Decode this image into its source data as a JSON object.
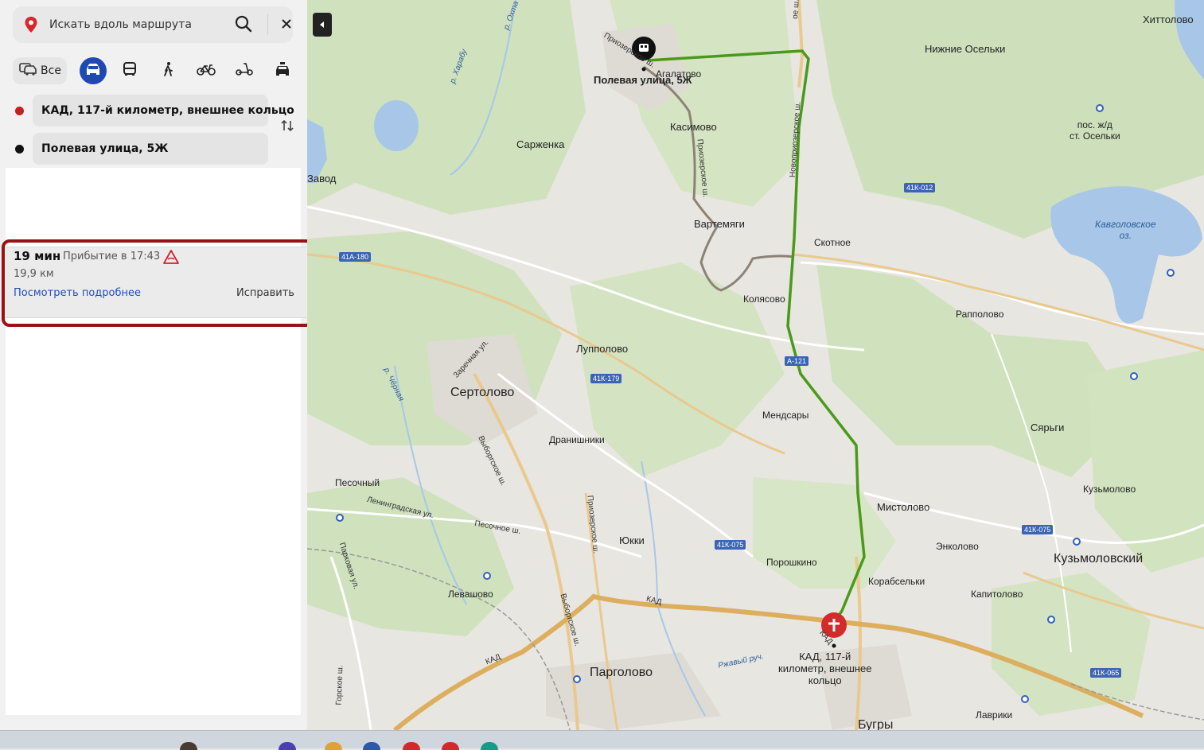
{
  "search": {
    "placeholder": "Искать вдоль маршрута"
  },
  "modes": {
    "all_label": "Все",
    "selected": "car",
    "accent": "#1f48b2"
  },
  "waypoints": {
    "from": "КАД, 117-й километр, внешнее кольцо",
    "to": "Полевая улица, 5Ж",
    "from_color": "#c81e1e",
    "to_color": "#111111"
  },
  "route": {
    "time": "19 мин",
    "arrival": "Прибытие в 17:43",
    "distance": "19,9 км",
    "details_link": "Посмотреть подробнее",
    "fix_button": "Исправить",
    "highlight_color": "#9c0f16",
    "route_color": "#4a9a1a"
  },
  "map": {
    "places": {
      "hittolovo": "Хиттолово",
      "nizhnie_oselki": "Нижние Осельки",
      "agalatovo": "Агалатово",
      "polevaya": "Полевая улица, 5Ж",
      "kasimovo": "Касимово",
      "sarzhenka": "Сарженка",
      "zavod": "Завод",
      "pos_oselki": "пос. ж/д\nст. Осельки",
      "vartemyagi": "Вартемяги",
      "skotnoe": "Скотное",
      "kavgolovskoe": "Кавголовское\nоз.",
      "kolyasovo": "Колясово",
      "rappolovo": "Рапполово",
      "luppolovo": "Лупполово",
      "sertolovo": "Сертолово",
      "mendsary": "Мендсары",
      "saryagi": "Сярьги",
      "dranishniki": "Дранишники",
      "pesochny": "Песочный",
      "kuzmolovo": "Кузьмолово",
      "mistolovo": "Мистолово",
      "yukki": "Юкки",
      "enkolovo": "Энколово",
      "kuzmolovsky": "Кузьмоловский",
      "poroshkino": "Порошкино",
      "korabselki": "Корабсельки",
      "levashovo": "Левашово",
      "kapitolovo": "Капитолово",
      "kad_point": "КАД, 117-й\nкилометр, внешнее\nкольцо",
      "pargolovo": "Парголово",
      "lavriki": "Лаврики",
      "bugry": "Бугры"
    },
    "roads": {
      "kad1": "КАД",
      "kad2": "КАД",
      "kad3": "КАД",
      "vyborgskoe": "Выборгское ш.",
      "vyborgskoe2": "Выборгское ш.",
      "novopriozerskoe": "Новоприозерское ш.",
      "priozerskoe": "Приозерское ш.",
      "priozerskoe2": "Приозерское ш.",
      "priozerskoe3": "Приозерское ш.",
      "leningradskaya": "Ленинградская ул.",
      "pesochnoe": "Песочное ш.",
      "parkovaya": "Парковая ул.",
      "zarechnaya": "Заречная ул.",
      "gorskoe": "Горское ш.",
      "ozerkoe": "ое ш."
    },
    "rivers": {
      "okhta": "р. Охта",
      "kharabryi": "р. Харабу",
      "chernaya": "р. Чёрная",
      "rzhavy": "Ржавый руч."
    },
    "shields": {
      "s1": "41А-180",
      "s2": "41К-179",
      "s3": "41К-012",
      "s4": "А-121",
      "s5": "41К-075",
      "s6": "41К-075",
      "s7": "41К-065"
    }
  }
}
